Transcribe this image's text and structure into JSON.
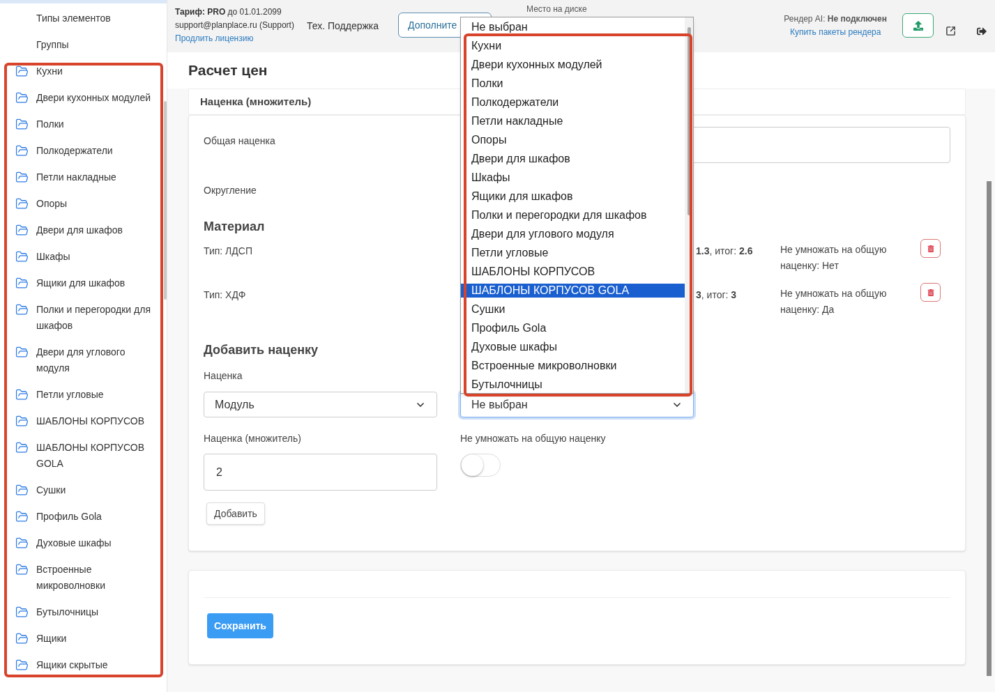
{
  "sidebar": {
    "highlight": true,
    "items": [
      {
        "label": "Типы элементов",
        "kind": "plain"
      },
      {
        "label": "Группы",
        "kind": "plain"
      },
      {
        "label": "Кухни",
        "kind": "folder"
      },
      {
        "label": "Двери кухонных модулей",
        "kind": "folder"
      },
      {
        "label": "Полки",
        "kind": "folder"
      },
      {
        "label": "Полкодержатели",
        "kind": "folder"
      },
      {
        "label": "Петли накладные",
        "kind": "folder"
      },
      {
        "label": "Опоры",
        "kind": "folder"
      },
      {
        "label": "Двери для шкафов",
        "kind": "folder"
      },
      {
        "label": "Шкафы",
        "kind": "folder"
      },
      {
        "label": "Ящики для шкафов",
        "kind": "folder"
      },
      {
        "label": "Полки и перегородки для шкафов",
        "kind": "folder"
      },
      {
        "label": "Двери для углового модуля",
        "kind": "folder"
      },
      {
        "label": "Петли угловые",
        "kind": "folder"
      },
      {
        "label": "ШАБЛОНЫ КОРПУСОВ",
        "kind": "folder"
      },
      {
        "label": "ШАБЛОНЫ КОРПУСОВ GOLA",
        "kind": "folder"
      },
      {
        "label": "Сушки",
        "kind": "folder"
      },
      {
        "label": "Профиль Gola",
        "kind": "folder"
      },
      {
        "label": "Духовые шкафы",
        "kind": "folder"
      },
      {
        "label": "Встроенные микроволновки",
        "kind": "folder"
      },
      {
        "label": "Бутылочницы",
        "kind": "folder"
      },
      {
        "label": "Ящики",
        "kind": "folder"
      },
      {
        "label": "Ящики скрытые",
        "kind": "folder"
      }
    ]
  },
  "header": {
    "tariff": "**Тариф: PRO** до 01.01.2099",
    "account": "support@planplace.ru (Support)",
    "renew_link": "Продлить лицензию",
    "support_link": "Тех. Поддержка",
    "extra_button": "Дополните",
    "disk_label": "Место на диске",
    "render_status": "Рендер AI: **Не подключен**",
    "render_link": "Купить пакеты рендера"
  },
  "page": {
    "title": "Расчет цен",
    "section_header": "Наценка (множитель)",
    "general_markup_label": "Общая наценка",
    "rounding_label": "Округление",
    "material": {
      "title": "Материал",
      "rows": [
        {
          "type": "Тип: ЛДСП",
          "result": "**1.3**, итог: **2.6**",
          "note": "Не умножать на общую наценку: Нет"
        },
        {
          "type": "Тип: ХДФ",
          "result": "**3**, итог: **3**",
          "note": "Не умножать на общую наценку: Да"
        }
      ]
    },
    "add_form": {
      "title": "Добавить наценку",
      "markup_label": "Наценка",
      "markup_select": "Модуль",
      "target_select": "Не выбран",
      "multiplier_label": "Наценка (множитель)",
      "multiplier_value": "2",
      "no_multiply_label": "Не умножать на общую наценку",
      "no_multiply_on": false,
      "add_button": "Добавить"
    },
    "save_button": "Сохранить"
  },
  "dropdown": {
    "highlight": true,
    "options": [
      {
        "label": "Не выбран",
        "selected": false
      },
      {
        "label": "Кухни",
        "selected": false
      },
      {
        "label": "Двери кухонных модулей",
        "selected": false
      },
      {
        "label": "Полки",
        "selected": false
      },
      {
        "label": "Полкодержатели",
        "selected": false
      },
      {
        "label": "Петли накладные",
        "selected": false
      },
      {
        "label": "Опоры",
        "selected": false
      },
      {
        "label": "Двери для шкафов",
        "selected": false
      },
      {
        "label": "Шкафы",
        "selected": false
      },
      {
        "label": "Ящики для шкафов",
        "selected": false
      },
      {
        "label": "Полки и перегородки для шкафов",
        "selected": false
      },
      {
        "label": "Двери для углового модуля",
        "selected": false
      },
      {
        "label": "Петли угловые",
        "selected": false
      },
      {
        "label": "ШАБЛОНЫ КОРПУСОВ",
        "selected": false
      },
      {
        "label": "ШАБЛОНЫ КОРПУСОВ GOLA",
        "selected": true
      },
      {
        "label": "Сушки",
        "selected": false
      },
      {
        "label": "Профиль Gola",
        "selected": false
      },
      {
        "label": "Духовые шкафы",
        "selected": false
      },
      {
        "label": "Встроенные микроволновки",
        "selected": false
      },
      {
        "label": "Бутылочницы",
        "selected": false
      }
    ]
  }
}
